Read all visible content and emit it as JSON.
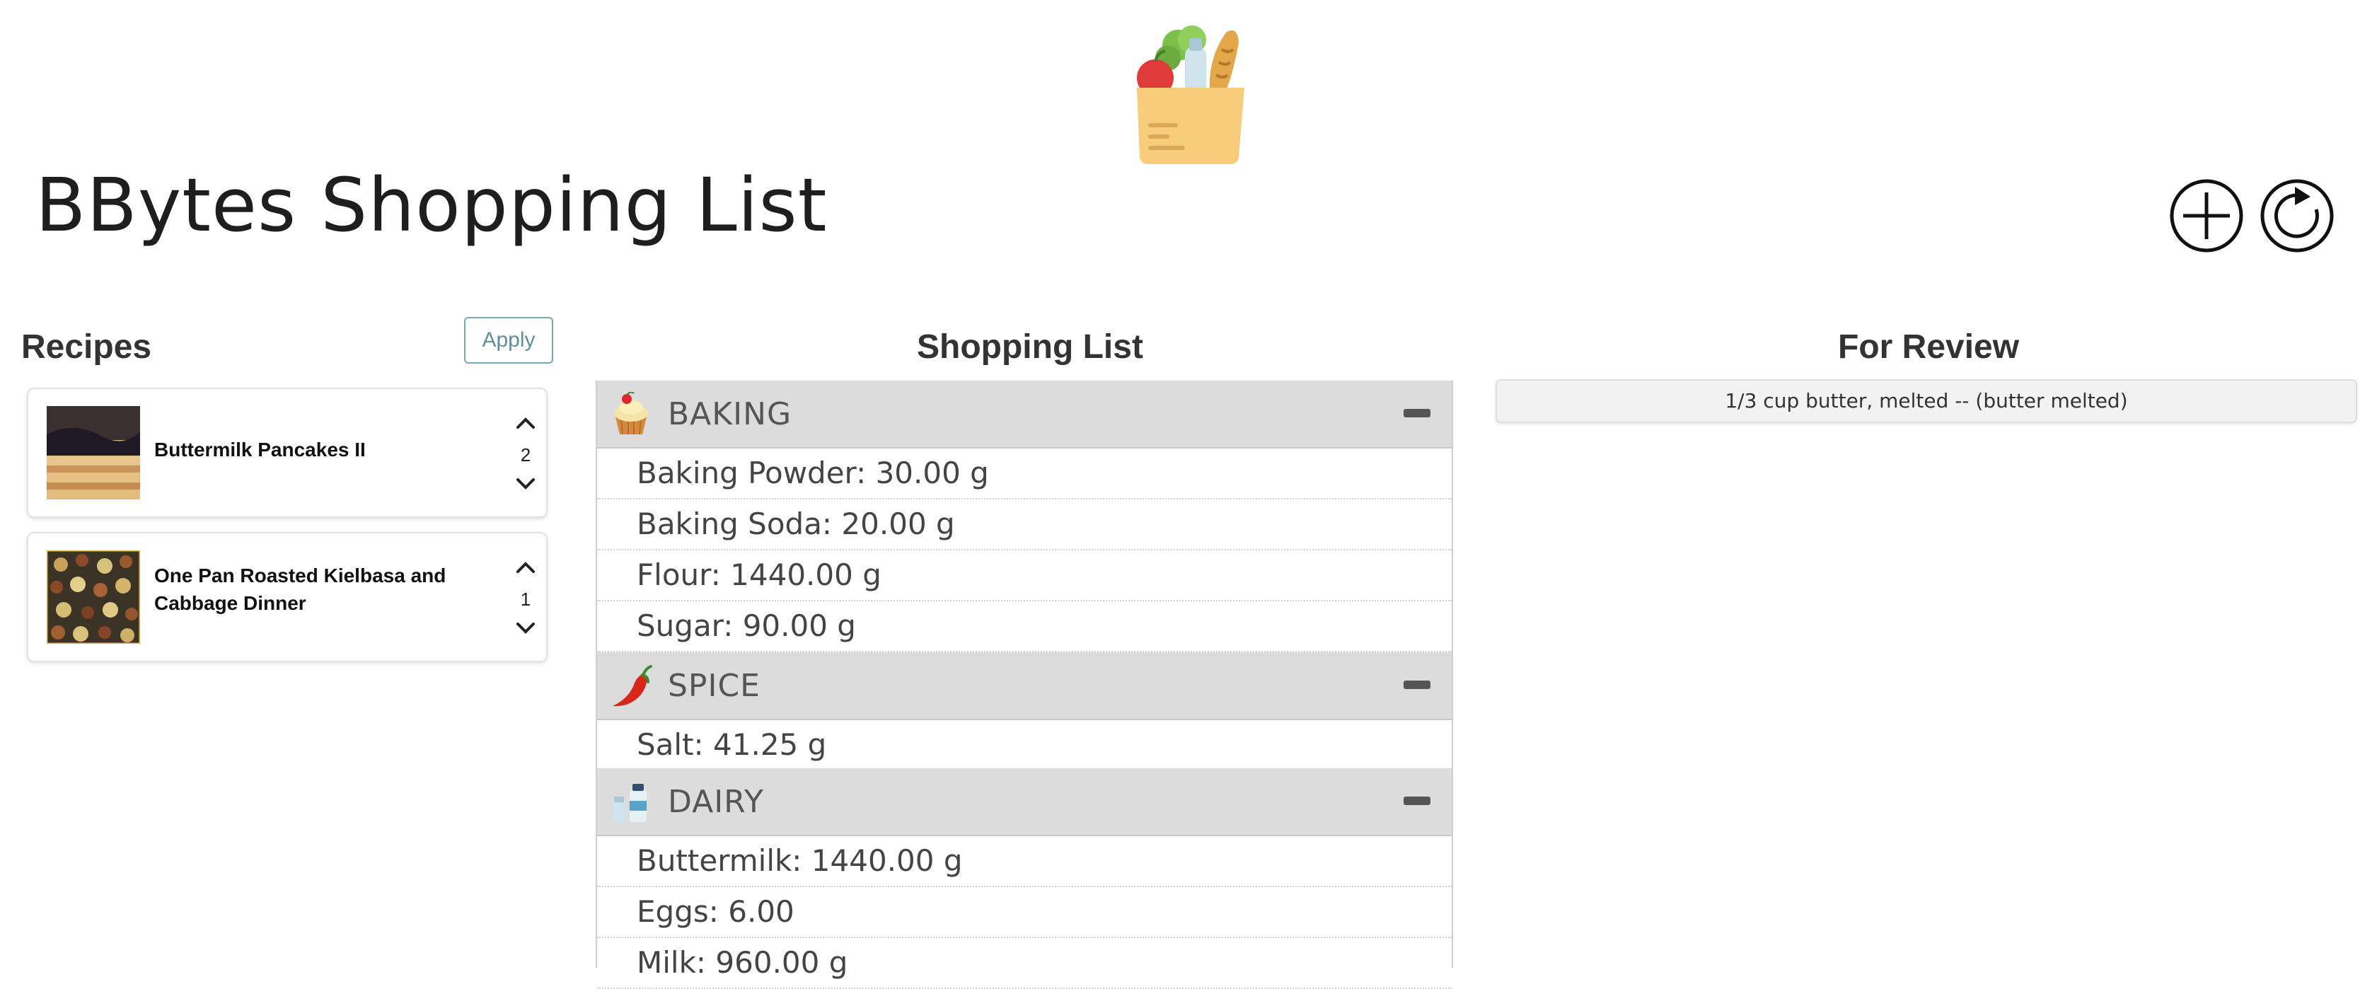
{
  "app": {
    "title": "BBytes Shopping List"
  },
  "header": {
    "logo_icon": "grocery-bag-icon",
    "add_icon": "plus-circle-icon",
    "refresh_icon": "refresh-circle-icon"
  },
  "recipes": {
    "heading": "Recipes",
    "apply_label": "Apply",
    "items": [
      {
        "name_lines": [
          "Buttermilk Pancakes II"
        ],
        "quantity": "2",
        "thumbnail_icon": "pancakes-photo"
      },
      {
        "name_lines": [
          "One Pan Roasted Kielbasa and",
          "Cabbage Dinner"
        ],
        "quantity": "1",
        "thumbnail_icon": "kielbasa-cabbage-photo"
      }
    ]
  },
  "shopping_list": {
    "heading": "Shopping List",
    "categories": [
      {
        "name": "BAKING",
        "icon": "cupcake-icon",
        "items": [
          "Baking Powder: 30.00 g",
          "Baking Soda: 20.00 g",
          "Flour: 1440.00 g",
          "Sugar: 90.00 g"
        ]
      },
      {
        "name": "SPICE",
        "icon": "chili-pepper-icon",
        "items": [
          "Salt: 41.25 g"
        ]
      },
      {
        "name": "DAIRY",
        "icon": "milk-bottles-icon",
        "items": [
          "Buttermilk: 1440.00 g",
          "Eggs: 6.00",
          "Milk: 960.00 g"
        ]
      }
    ]
  },
  "for_review": {
    "heading": "For Review",
    "items": [
      "1/3 cup butter, melted -- (butter melted)"
    ]
  },
  "colors": {
    "category_header_bg": "#dcdcdc",
    "apply_border": "#7aa7b0",
    "review_bg": "#f2f2f2"
  }
}
